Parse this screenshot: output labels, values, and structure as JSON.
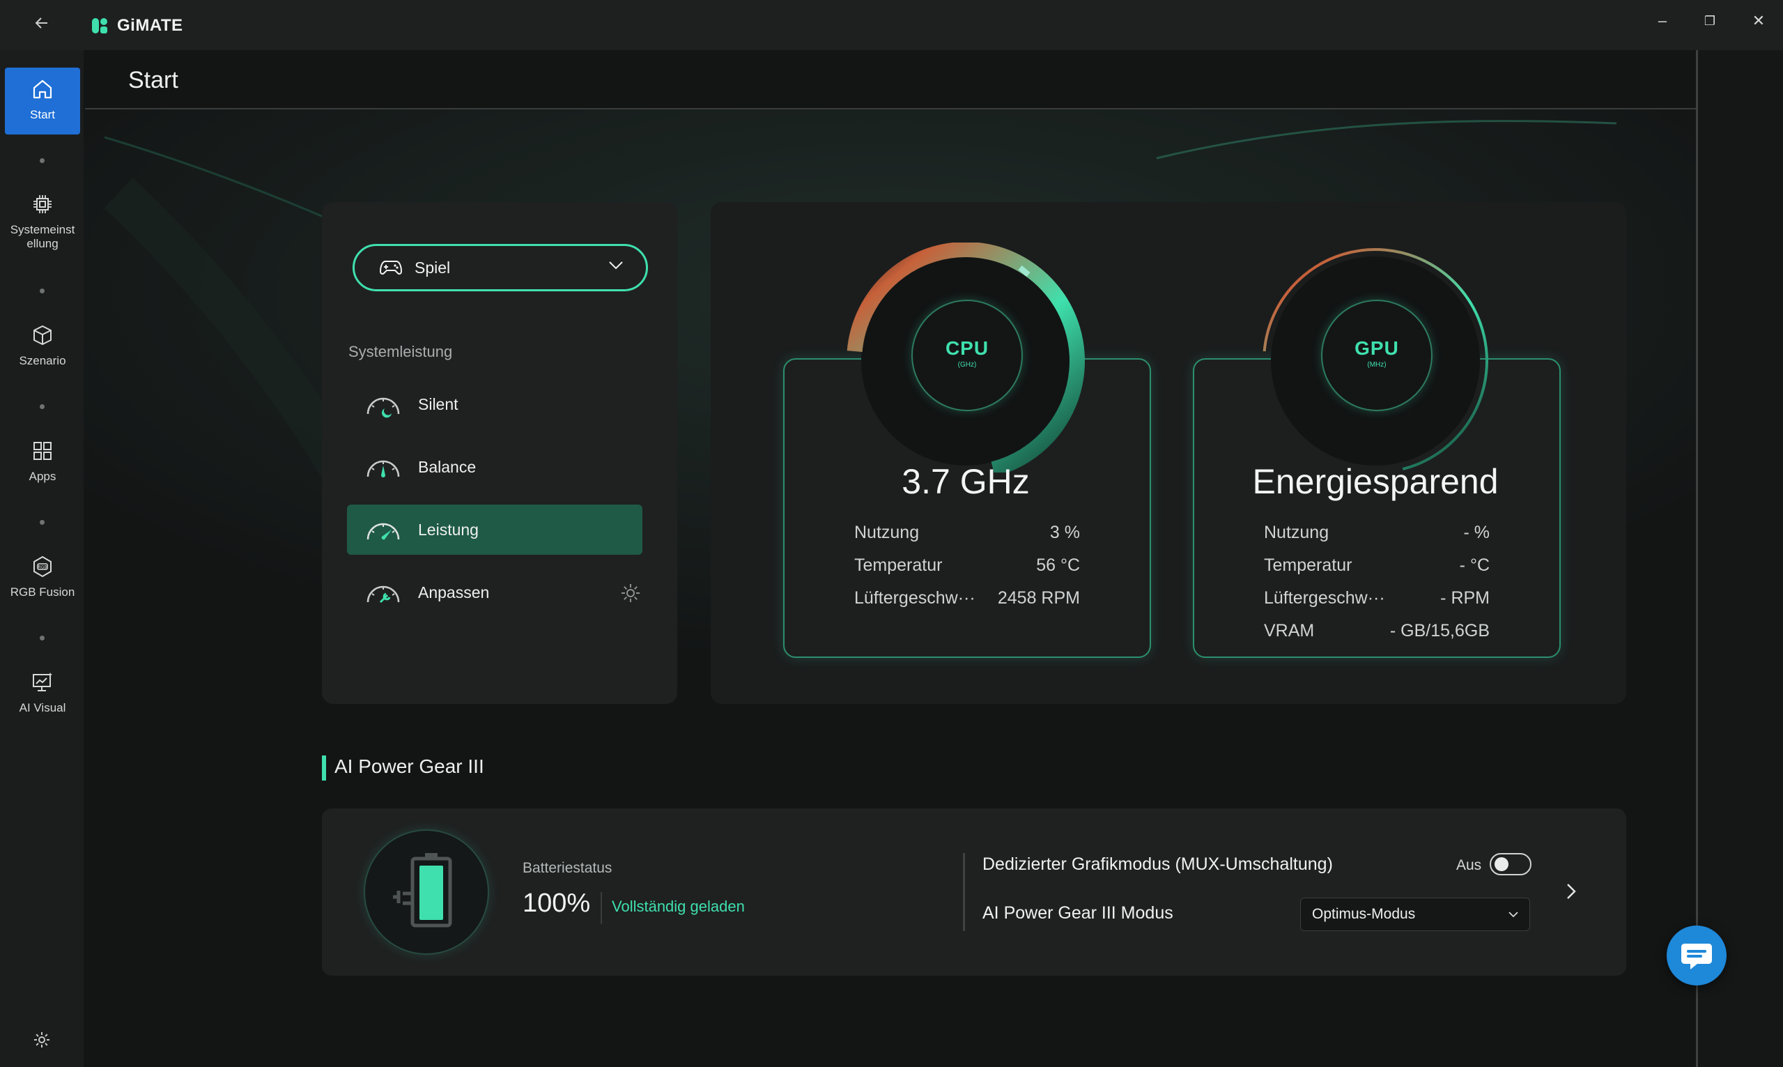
{
  "app": {
    "name": "GiMATE",
    "back_icon": "back-arrow-icon"
  },
  "window": {
    "minimize": "–",
    "restore": "❐",
    "close": "✕"
  },
  "sidebar": {
    "items": [
      {
        "label": "Start",
        "icon": "home-icon",
        "active": true
      },
      {
        "label": "Systemeinstellung",
        "line1": "Systemeinst",
        "line2": "ellung",
        "icon": "chip-icon"
      },
      {
        "label": "Szenario",
        "icon": "cube-icon"
      },
      {
        "label": "Apps",
        "icon": "apps-grid-icon"
      },
      {
        "label": "RGB Fusion",
        "icon": "rgb-icon"
      },
      {
        "label": "AI Visual",
        "icon": "ai-visual-icon"
      }
    ],
    "settings_icon": "gear-icon"
  },
  "page": {
    "title": "Start"
  },
  "modes": {
    "selected": "Spiel",
    "section_label": "Systemleistung",
    "items": [
      {
        "label": "Silent",
        "icon": "gauge-silent-icon"
      },
      {
        "label": "Balance",
        "icon": "gauge-balance-icon"
      },
      {
        "label": "Leistung",
        "icon": "gauge-performance-icon",
        "active": true
      },
      {
        "label": "Anpassen",
        "icon": "gauge-custom-icon"
      }
    ]
  },
  "cpu": {
    "chip_label": "CPU",
    "chip_unit": "(GHz)",
    "value": "3.7 GHz",
    "rows": [
      {
        "key": "Nutzung",
        "value": "3 %"
      },
      {
        "key": "Temperatur",
        "value": "56 °C"
      },
      {
        "key": "Lüftergeschw···",
        "value": "2458 RPM"
      }
    ]
  },
  "gpu": {
    "chip_label": "GPU",
    "chip_unit": "(MHz)",
    "value": "Energiesparend",
    "rows": [
      {
        "key": "Nutzung",
        "value": "- %"
      },
      {
        "key": "Temperatur",
        "value": "- °C"
      },
      {
        "key": "Lüftergeschw···",
        "value": "- RPM"
      },
      {
        "key": "VRAM",
        "value": "- GB/15,6GB"
      }
    ]
  },
  "ai_power_gear": {
    "title": "AI Power Gear III",
    "battery_label": "Batteriestatus",
    "battery_percent": "100%",
    "battery_status": "Vollständig geladen",
    "mux_label": "Dedizierter Grafikmodus (MUX-Umschaltung)",
    "mux_state": "Aus",
    "mux_enabled": false,
    "mode_label": "AI Power Gear III Modus",
    "mode_value": "Optimus-Modus"
  },
  "colors": {
    "accent": "#3fe0ad",
    "active_nav": "#1f6fd6",
    "active_mode": "#1f5a46",
    "fab": "#1e88d9"
  }
}
